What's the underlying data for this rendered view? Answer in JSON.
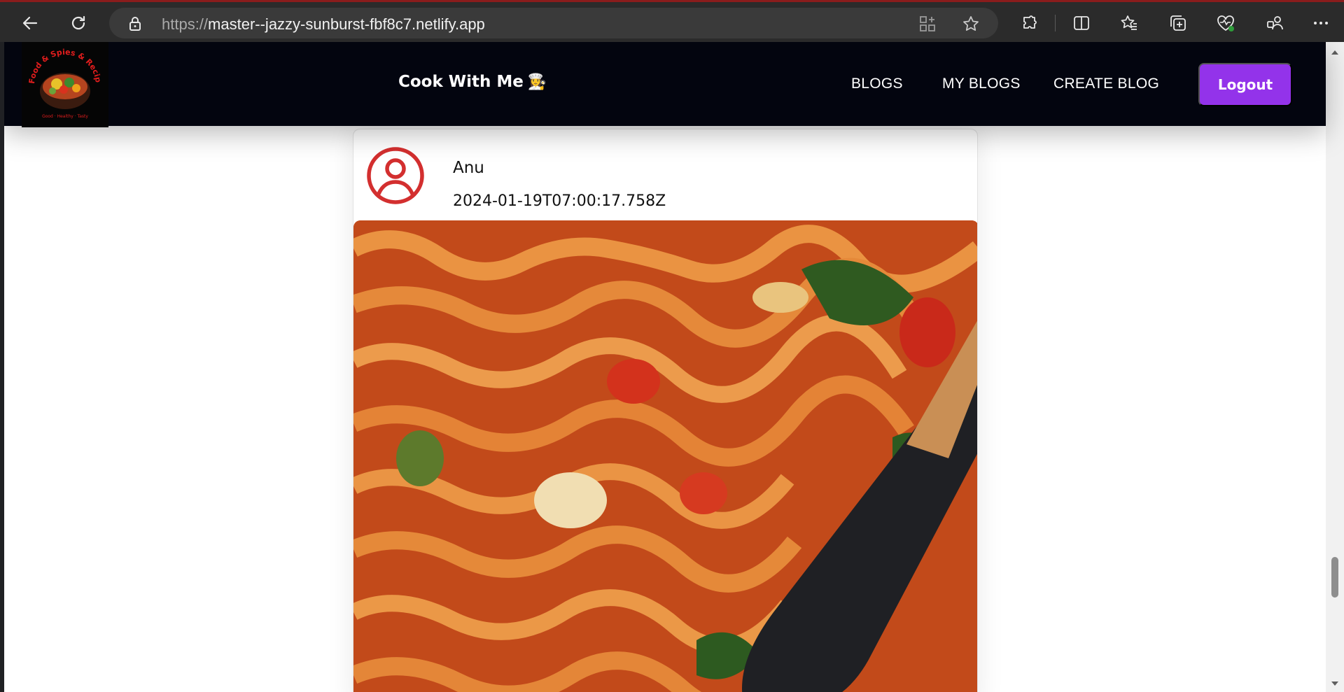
{
  "browser": {
    "url_scheme": "https://",
    "url_host": "master--jazzy-sunburst-fbf8c7.netlify.app",
    "icons": [
      "back-icon",
      "refresh-icon",
      "lock-icon",
      "app-grid-icon",
      "favorite-star-icon",
      "extensions-icon",
      "split-screen-icon",
      "favorites-icon",
      "collections-icon",
      "health-icon",
      "profile-icon",
      "more-icon"
    ]
  },
  "site": {
    "brand": "Cook With Me",
    "brand_emoji": "👩‍🍳",
    "logo_text": "Food & Spies & Recipe",
    "logo_subtext": "Good · Healthy · Tasty",
    "nav": {
      "blogs": "BLOGS",
      "my_blogs": "MY BLOGS",
      "create_blog": "CREATE BLOG"
    },
    "logout_label": "Logout",
    "accent": "#9333ea",
    "header_bg": "#03050f"
  },
  "post": {
    "author": "Anu",
    "timestamp": "2024-01-19T07:00:17.758Z",
    "avatar_color": "#d32f2f",
    "image_subject": "pasta-dish"
  }
}
